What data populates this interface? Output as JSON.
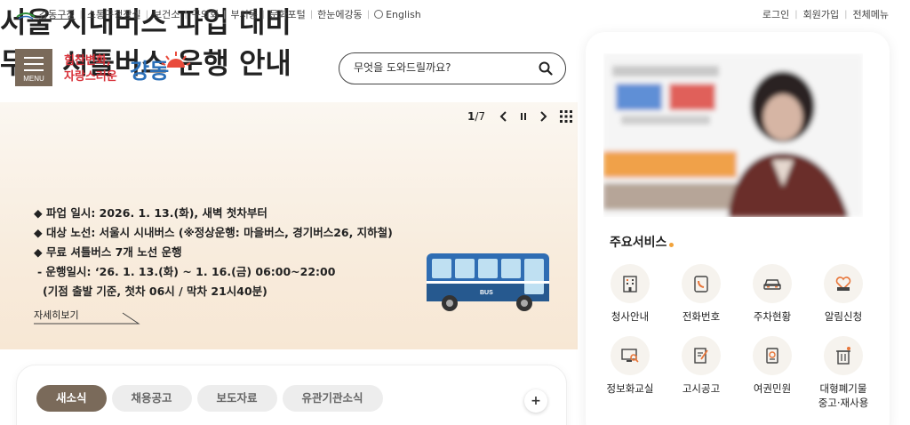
{
  "topbar": {
    "links": [
      "강동구청",
      "소통구청장실",
      "보건소",
      "구의회",
      "부서동",
      "문화포털",
      "한눈에강동"
    ],
    "english": "English",
    "login": "로그인",
    "signup": "회원가입",
    "sitemap": "전체메뉴"
  },
  "header": {
    "menu_label": "MENU",
    "brand_slogan": "힘찬변화, 자랑스러운",
    "brand_name": "강동",
    "search_placeholder": "무엇을 도와드릴까요?"
  },
  "banner": {
    "pager_current": "1",
    "pager_total": "/7",
    "title_line1": "서울 시내버스 파업 대비",
    "title_line2": "무료 셔틀버스 운행 안내",
    "bullet1": "◆ 파업 일시: 2026. 1. 13.(화), 새벽 첫차부터",
    "bullet2": "◆ 대상 노선: 서울시 시내버스 (※정상운행: 마을버스, 경기버스26, 지하철)",
    "bullet3": "◆ 무료 셔틀버스 7개 노선 운행",
    "bullet4": "- 운행일시: ‘26. 1. 13.(화) ~ 1. 16.(금) 06:00~22:00",
    "bullet5": "(기점 출발 기준, 첫차 06시 / 막차 21시40분)",
    "more": "자세히보기",
    "bus_label": "BUS"
  },
  "news": {
    "tabs": [
      "새소식",
      "채용공고",
      "보도자료",
      "유관기관소식"
    ],
    "plus": "+"
  },
  "services": {
    "title": "주요서비스",
    "items": [
      {
        "label": "청사안내",
        "icon": "building-icon"
      },
      {
        "label": "전화번호",
        "icon": "phone-icon"
      },
      {
        "label": "주차현황",
        "icon": "car-icon"
      },
      {
        "label": "알림신청",
        "icon": "wish-heart-icon"
      },
      {
        "label": "정보화교실",
        "icon": "monitor-search-icon"
      },
      {
        "label": "고시공고",
        "icon": "notice-pen-icon"
      },
      {
        "label": "여권민원",
        "icon": "passport-icon"
      },
      {
        "label": "대형폐기물\n중고·재사용",
        "icon": "trash-bin-icon"
      }
    ]
  },
  "colors": {
    "brand_brown": "#7a6a5a",
    "accent_orange": "#f2a33a",
    "banner_bg": "#f8ecdd",
    "bus_blue": "#2f6db3"
  }
}
